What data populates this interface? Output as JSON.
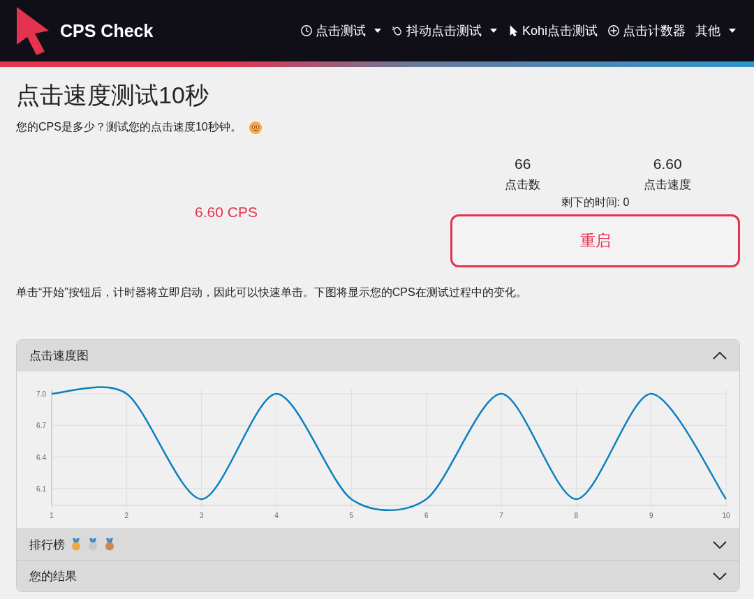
{
  "brand": {
    "name": "CPS Check"
  },
  "nav": [
    {
      "label": "点击测试",
      "kind": "clock",
      "dropdown": true
    },
    {
      "label": "抖动点击测试",
      "kind": "mouse",
      "dropdown": true
    },
    {
      "label": "Kohi点击测试",
      "kind": "pointer",
      "dropdown": false
    },
    {
      "label": "点击计数器",
      "kind": "plus",
      "dropdown": false
    },
    {
      "label": "其他",
      "kind": "text",
      "dropdown": true
    }
  ],
  "title": "点击速度测试10秒",
  "subtitle": "您的CPS是多少？测试您的点击速度10秒钟。",
  "result": "6.60 CPS",
  "stats": [
    {
      "value": "66",
      "label": "点击数"
    },
    {
      "value": "6.60",
      "label": "点击速度"
    }
  ],
  "remaining": "剩下的时间: 0",
  "restart_button": "重启",
  "description": "单击“开始”按钮后，计时器将立即启动，因此可以快速单击。下图将显示您的CPS在测试过程中的变化。",
  "sections": [
    {
      "title": "点击速度图",
      "kind": "chart",
      "expanded": true,
      "chart_data": {
        "type": "line",
        "x": [
          1,
          2,
          3,
          4,
          5,
          6,
          7,
          8,
          9,
          10
        ],
        "grid": true,
        "series": [
          {
            "color": "#0a7fc0",
            "values": [
              7.0,
              7.0,
              6.0,
              7.0,
              6.0,
              6.0,
              7.0,
              6.0,
              7.0,
              6.0
            ]
          }
        ],
        "xticks": [
          1,
          2,
          3,
          4,
          5,
          6,
          7,
          8,
          9,
          10
        ],
        "yticks": [
          {
            "value": 6.1,
            "label": "6.1"
          },
          {
            "value": 6.4,
            "label": "6.4"
          },
          {
            "value": 6.7,
            "label": "6.7"
          },
          {
            "value": 7.0,
            "label": "7.0"
          }
        ],
        "ylim": [
          5.94,
          7.0
        ],
        "xlim": [
          1,
          10
        ]
      }
    },
    {
      "title": "排行榜",
      "kind": "medals",
      "expanded": false
    },
    {
      "title": "您的结果",
      "kind": "plain",
      "expanded": false
    }
  ]
}
